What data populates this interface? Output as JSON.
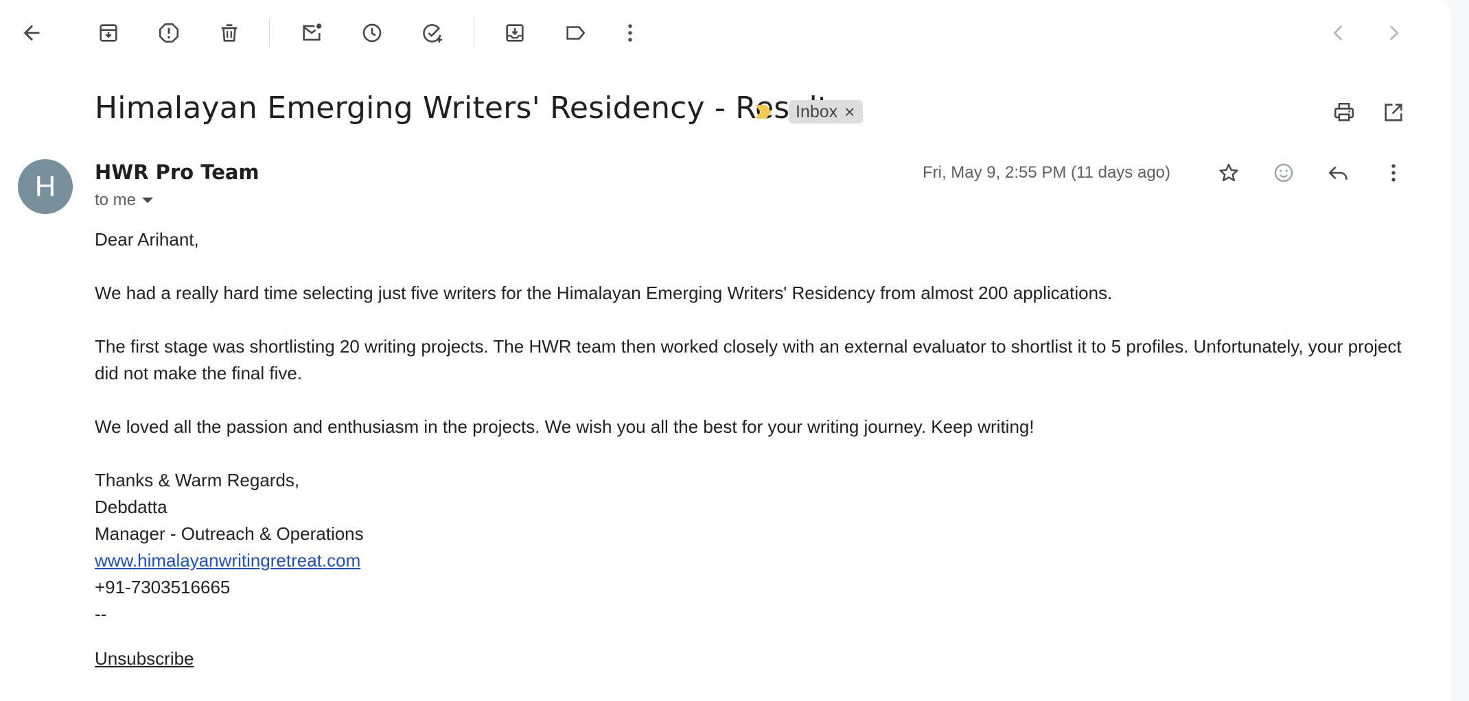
{
  "toolbar": {
    "icons": [
      "back-arrow-icon",
      "archive-icon",
      "report-spam-icon",
      "delete-icon",
      "mark-unread-icon",
      "snooze-icon",
      "add-to-tasks-icon",
      "move-to-icon",
      "label-icon",
      "more-vert-icon",
      "chevron-left-icon",
      "chevron-right-icon"
    ]
  },
  "email": {
    "subject": "Himalayan Emerging Writers' Residency - Result",
    "label": "Inbox",
    "label_remove": "×",
    "sender_initial": "H",
    "sender_name": "HWR Pro Team",
    "recipient": "to me",
    "date": "Fri, May 9, 2:55 PM (11 days ago)",
    "greeting": "Dear Arihant,",
    "paragraphs": [
      "We had a really hard time selecting just five writers for the Himalayan Emerging Writers' Residency from almost 200 applications.",
      "The first stage was shortlisting 20 writing projects. The HWR team then worked closely with an external evaluator to shortlist it to 5 profiles. Unfortunately, your project did not make the final five.",
      "We loved all the passion and enthusiasm in the projects. We wish you all the best for your writing journey. Keep writing!"
    ],
    "signature": {
      "closing": "Thanks & Warm Regards,",
      "name": "Debdatta",
      "title": "Manager - Outreach & Operations",
      "website": "www.himalayanwritingretreat.com",
      "phone": "+91-7303516665",
      "separator": "--"
    },
    "unsubscribe": "Unsubscribe"
  },
  "colors": {
    "avatar": "#78909c",
    "importance_marker": "#f2c94c",
    "link": "#1a4fc9",
    "chip_bg": "#dddddd"
  }
}
